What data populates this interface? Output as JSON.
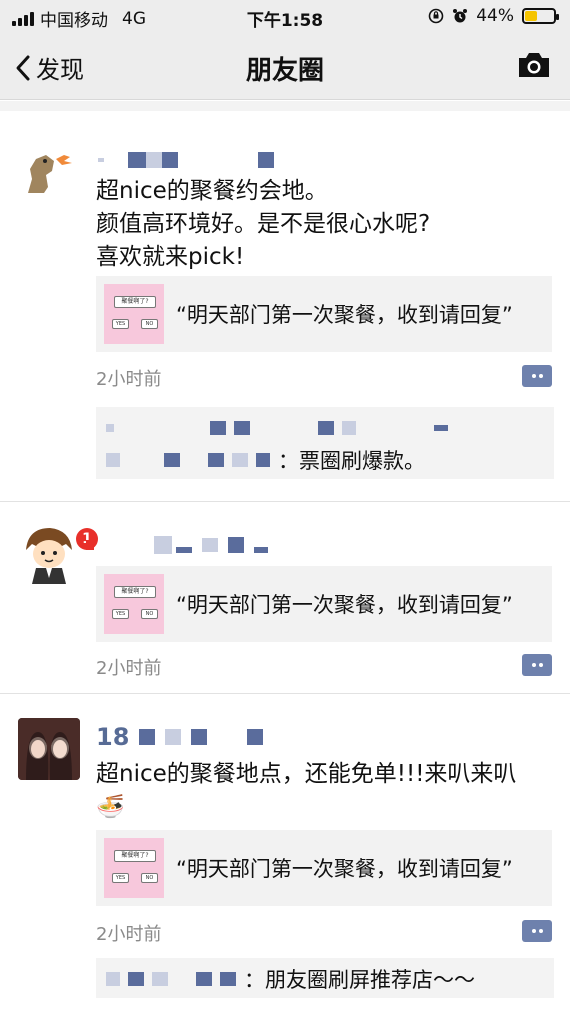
{
  "status": {
    "carrier": "中国移动",
    "network": "4G",
    "time": "下午1:58",
    "battery": "44%",
    "battery_level": 0.44
  },
  "nav": {
    "back_label": "发现",
    "title": "朋友圈"
  },
  "posts": [
    {
      "content_lines": [
        "超nice的聚餐约会地。",
        "颜值高环境好。是不是很心水呢?",
        "喜欢就来pick!"
      ],
      "share": {
        "title": "“明天部门第一次聚餐，收到请回复”",
        "thumb_q": "聚餐啊了?",
        "thumb_yes": "YES",
        "thumb_no": "NO"
      },
      "time": "2小时前",
      "comment": "：票圈刷爆款。"
    },
    {
      "badge": "1",
      "share": {
        "title": "“明天部门第一次聚餐，收到请回复”",
        "thumb_q": "聚餐啊了?",
        "thumb_yes": "YES",
        "thumb_no": "NO"
      },
      "time": "2小时前"
    },
    {
      "name_prefix": "18",
      "content_lines": [
        "超nice的聚餐地点，还能免单!!!来叭来叭",
        "🍜"
      ],
      "share": {
        "title": "“明天部门第一次聚餐，收到请回复”",
        "thumb_q": "聚餐啊了?",
        "thumb_yes": "YES",
        "thumb_no": "NO"
      },
      "time": "2小时前",
      "comment": "：朋友圈刷屏推荐店～～"
    }
  ],
  "icons": {
    "back": "chevron-left-icon",
    "camera": "camera-icon",
    "more": "comment-more-icon"
  },
  "colors": {
    "name_link": "#576b95",
    "badge": "#e8302a",
    "battery_fill": "#f5c400",
    "thumb_bg": "#f7c8dc"
  }
}
